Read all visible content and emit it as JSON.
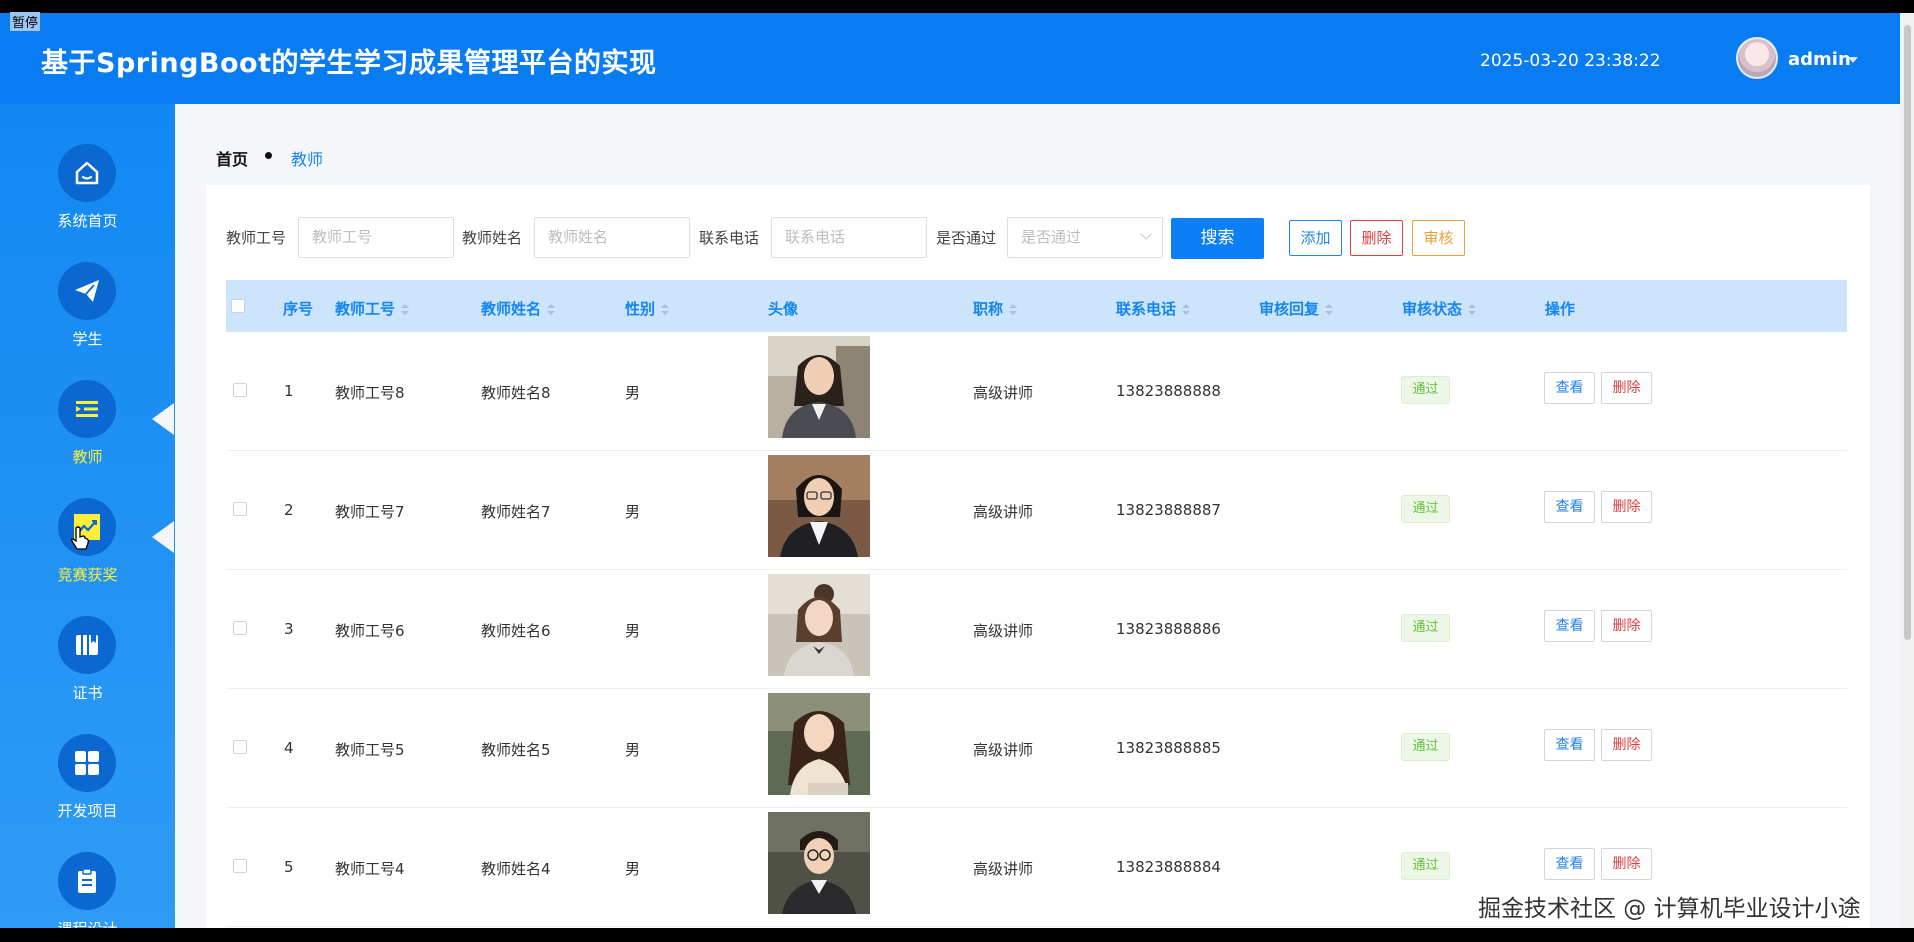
{
  "header": {
    "title": "基于SpringBoot的学生学习成果管理平台的实现",
    "datetime": "2025-03-20 23:38:22",
    "username": "admin"
  },
  "overlay": {
    "pause_label": "暂停",
    "watermark": "掘金技术社区 @ 计算机毕业设计小途"
  },
  "sidebar": {
    "items": [
      {
        "label": "系统首页",
        "icon": "home-icon"
      },
      {
        "label": "学生",
        "icon": "paper-plane-icon"
      },
      {
        "label": "教师",
        "icon": "list-indent-icon",
        "active": true
      },
      {
        "label": "竞赛获奖",
        "icon": "chart-line-icon",
        "hover": true
      },
      {
        "label": "证书",
        "icon": "book-icon"
      },
      {
        "label": "开发项目",
        "icon": "grid-icon"
      },
      {
        "label": "课程设计",
        "icon": "clipboard-icon"
      }
    ]
  },
  "breadcrumb": {
    "home": "首页",
    "current": "教师"
  },
  "filters": {
    "teacher_no_label": "教师工号",
    "teacher_no_placeholder": "教师工号",
    "teacher_name_label": "教师姓名",
    "teacher_name_placeholder": "教师姓名",
    "phone_label": "联系电话",
    "phone_placeholder": "联系电话",
    "approved_label": "是否通过",
    "approved_placeholder": "是否通过"
  },
  "toolbar": {
    "search": "搜索",
    "add": "添加",
    "delete": "删除",
    "audit": "审核"
  },
  "table": {
    "columns": [
      "序号",
      "教师工号",
      "教师姓名",
      "性别",
      "头像",
      "职称",
      "联系电话",
      "审核回复",
      "审核状态",
      "操作"
    ],
    "rows": [
      {
        "index": "1",
        "teacher_no": "教师工号8",
        "name": "教师姓名8",
        "gender": "男",
        "title": "高级讲师",
        "phone": "13823888888",
        "reply": "",
        "status": "通过",
        "view": "查看",
        "delete": "删除"
      },
      {
        "index": "2",
        "teacher_no": "教师工号7",
        "name": "教师姓名7",
        "gender": "男",
        "title": "高级讲师",
        "phone": "13823888887",
        "reply": "",
        "status": "通过",
        "view": "查看",
        "delete": "删除"
      },
      {
        "index": "3",
        "teacher_no": "教师工号6",
        "name": "教师姓名6",
        "gender": "男",
        "title": "高级讲师",
        "phone": "13823888886",
        "reply": "",
        "status": "通过",
        "view": "查看",
        "delete": "删除"
      },
      {
        "index": "4",
        "teacher_no": "教师工号5",
        "name": "教师姓名5",
        "gender": "男",
        "title": "高级讲师",
        "phone": "13823888885",
        "reply": "",
        "status": "通过",
        "view": "查看",
        "delete": "删除"
      },
      {
        "index": "5",
        "teacher_no": "教师工号4",
        "name": "教师姓名4",
        "gender": "男",
        "title": "高级讲师",
        "phone": "13823888884",
        "reply": "",
        "status": "通过",
        "view": "查看",
        "delete": "删除"
      }
    ]
  },
  "colors": {
    "primary": "#0a7cf2",
    "header_bg": "#0a7cf2",
    "table_head_bg": "#cde4fd",
    "active_label": "#ffef3a",
    "danger": "#df3f3f",
    "warning": "#e6a23c",
    "success": "#66c23a"
  }
}
